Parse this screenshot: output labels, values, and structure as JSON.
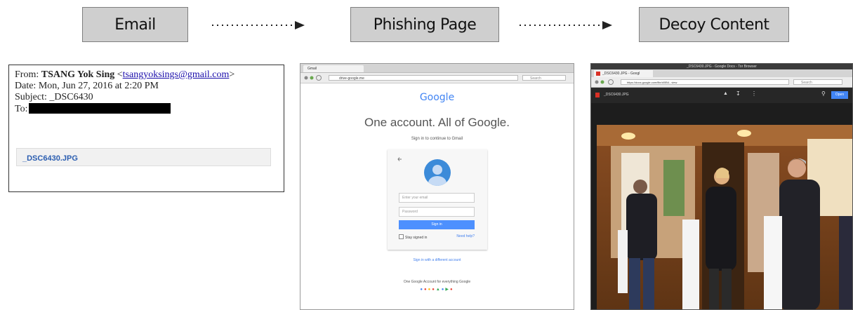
{
  "stages": {
    "email": "Email",
    "phishing": "Phishing Page",
    "decoy": "Decoy Content"
  },
  "email": {
    "from_label": "From:",
    "from_name": "TSANG Yok Sing",
    "from_email": "tsangyoksings@gmail.com",
    "date_line": "Date: Mon, Jun 27, 2016 at 2:20 PM",
    "subject_line": "Subject: _DSC6430",
    "to_label": "To:",
    "attachment": "_DSC6430.JPG"
  },
  "phishing_page": {
    "tab_title": "Gmail",
    "url": "drive-google.me",
    "search_placeholder": "Search",
    "logo": "Google",
    "headline": "One account. All of Google.",
    "subtitle": "Sign in to continue to Gmail",
    "email_placeholder": "Enter your email",
    "password_placeholder": "Password",
    "signin_button": "Sign in",
    "stay_signed_in": "Stay signed in",
    "need_help": "Need help?",
    "different_account": "Sign in with a different account",
    "footer": "One Google Account for everything Google"
  },
  "decoy_page": {
    "window_title": "_DSC6430.JPG - Google Docs - Tor Browser",
    "tab_title": "_DSC6430.JPG - Googl",
    "url": "https://docs.google.com/file/d/0B4...view",
    "search_placeholder": "Search",
    "file_name": "_DSC6430.JPG",
    "open_button": "Open"
  },
  "colors": {
    "stage_box": "#cfcfcf",
    "google_blue": "#4285f4",
    "attachment_link": "#2a5db0"
  }
}
